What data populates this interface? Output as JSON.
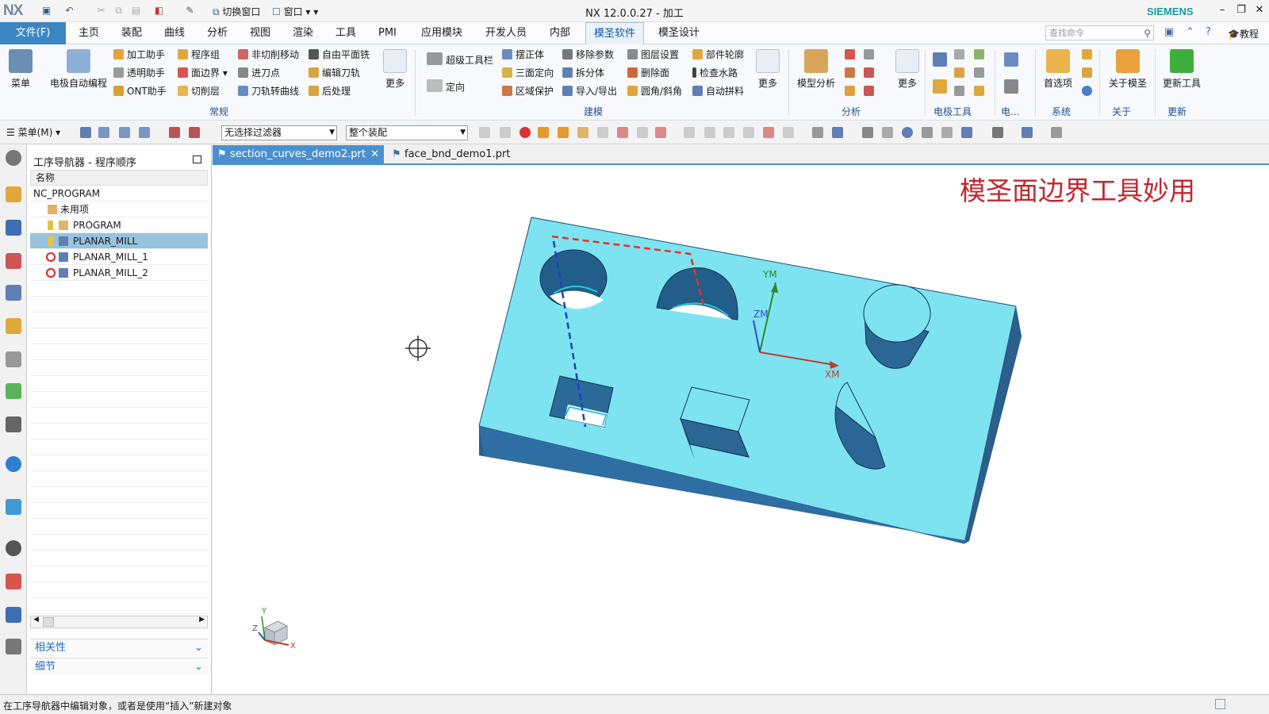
{
  "app": {
    "logo": "NX",
    "window_title": "NX 12.0.0.27 - 加工",
    "brand": "SIEMENS",
    "quick_switch": "切换窗口",
    "quick_window": "窗口"
  },
  "menu": {
    "file": "文件(F)",
    "tabs": [
      "主页",
      "装配",
      "曲线",
      "分析",
      "视图",
      "渲染",
      "工具",
      "PMI",
      "应用模块",
      "开发人员",
      "内部",
      "模圣软件",
      "模圣设计"
    ],
    "active_tab": "模圣软件",
    "search_placeholder": "查找命令",
    "tutorial": "教程"
  },
  "ribbon": {
    "menu_btn": "菜单",
    "auto_prog": "电极自动编程",
    "col1": [
      "加工助手",
      "透明助手",
      "ONT助手"
    ],
    "col2": [
      "程序组",
      "面边界",
      "切削层"
    ],
    "col3": [
      "非切削移动",
      "进刀点",
      "刀轨转曲线"
    ],
    "col4": [
      "自由平面铣",
      "编辑刀轨",
      "后处理"
    ],
    "more": "更多",
    "group_common": "常规",
    "super_toolbar": "超级工具栏",
    "orient": "定向",
    "col5": [
      "摆正体",
      "三面定向",
      "区域保护"
    ],
    "col6": [
      "移除参数",
      "拆分体",
      "导入/导出"
    ],
    "col7": [
      "图层设置",
      "删除面",
      "圆角/斜角"
    ],
    "col8": [
      "部件轮廓",
      "检查水路",
      "自动拼料"
    ],
    "group_model": "建模",
    "model_analysis": "模型分析",
    "group_analysis": "分析",
    "group_electrode": "电极工具",
    "group_e2": "电...",
    "preferences": "首选项",
    "group_system": "系统",
    "about": "关于模圣",
    "group_about": "关于",
    "update_tools": "更新工具",
    "group_update": "更新"
  },
  "toolbar2": {
    "menu": "菜单(M)",
    "filter": "无选择过滤器",
    "assembly": "整个装配"
  },
  "navigator": {
    "title": "工序导航器 - 程序顺序",
    "column": "名称",
    "rows": [
      "NC_PROGRAM",
      "未用项",
      "PROGRAM",
      "PLANAR_MILL",
      "PLANAR_MILL_1",
      "PLANAR_MILL_2"
    ],
    "selected": "PLANAR_MILL",
    "acc1": "相关性",
    "acc2": "细节"
  },
  "doc_tabs": [
    "section_curves_demo2.prt",
    "face_bnd_demo1.prt"
  ],
  "viewport": {
    "title": "模圣面边界工具妙用",
    "axis_ym": "YM",
    "axis_zm": "ZM",
    "axis_xm": "XM",
    "triad_y": "Y",
    "triad_z": "Z",
    "triad_x": "X"
  },
  "status": "在工序导航器中编辑对象，或者是使用“插入”新建对象"
}
